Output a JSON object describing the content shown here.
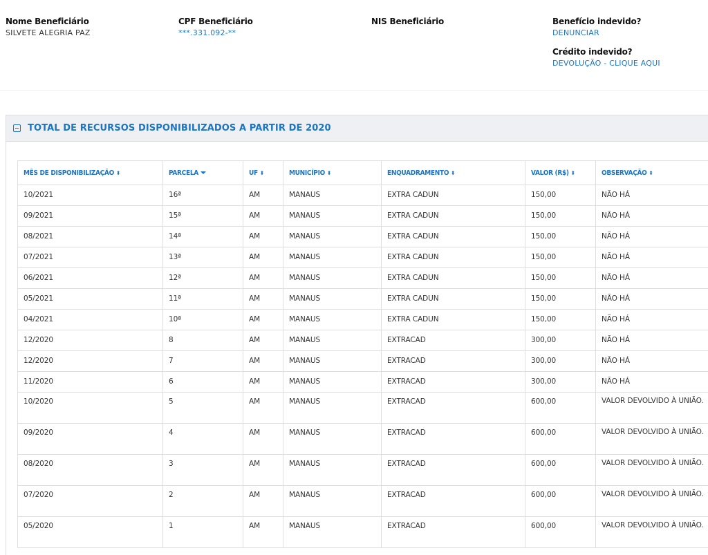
{
  "beneficiary": {
    "name_label": "Nome Beneficiário",
    "name_value": "SILVETE ALEGRIA PAZ",
    "cpf_label": "CPF Beneficiário",
    "cpf_value": "***.331.092-**",
    "nis_label": "NIS Beneficiário",
    "nis_value": "",
    "undue_benefit_label": "Benefício indevido?",
    "undue_benefit_link": "DENUNCIAR",
    "undue_credit_label": "Crédito indevido?",
    "undue_credit_link": "DEVOLUÇÃO - CLIQUE AQUI"
  },
  "panel": {
    "title": "TOTAL DE RECURSOS DISPONIBILIZADOS A PARTIR DE 2020",
    "icon": "collapse-minus-icon"
  },
  "table": {
    "columns": [
      {
        "label": "MÊS DE DISPONIBILIZAÇÃO",
        "sort": "both"
      },
      {
        "label": "PARCELA",
        "sort": "desc"
      },
      {
        "label": "UF",
        "sort": "both"
      },
      {
        "label": "MUNICÍPIO",
        "sort": "both"
      },
      {
        "label": "ENQUADRAMENTO",
        "sort": "both"
      },
      {
        "label": "VALOR (R$)",
        "sort": "both"
      },
      {
        "label": "OBSERVAÇÃO",
        "sort": "both"
      }
    ],
    "rows": [
      {
        "mes": "10/2021",
        "parcela": "16ª",
        "uf": "AM",
        "municipio": "MANAUS",
        "enquadramento": "EXTRA CADUN",
        "valor": "150,00",
        "observacao": "NÃO HÁ"
      },
      {
        "mes": "09/2021",
        "parcela": "15ª",
        "uf": "AM",
        "municipio": "MANAUS",
        "enquadramento": "EXTRA CADUN",
        "valor": "150,00",
        "observacao": "NÃO HÁ"
      },
      {
        "mes": "08/2021",
        "parcela": "14ª",
        "uf": "AM",
        "municipio": "MANAUS",
        "enquadramento": "EXTRA CADUN",
        "valor": "150,00",
        "observacao": "NÃO HÁ"
      },
      {
        "mes": "07/2021",
        "parcela": "13ª",
        "uf": "AM",
        "municipio": "MANAUS",
        "enquadramento": "EXTRA CADUN",
        "valor": "150,00",
        "observacao": "NÃO HÁ"
      },
      {
        "mes": "06/2021",
        "parcela": "12ª",
        "uf": "AM",
        "municipio": "MANAUS",
        "enquadramento": "EXTRA CADUN",
        "valor": "150,00",
        "observacao": "NÃO HÁ"
      },
      {
        "mes": "05/2021",
        "parcela": "11ª",
        "uf": "AM",
        "municipio": "MANAUS",
        "enquadramento": "EXTRA CADUN",
        "valor": "150,00",
        "observacao": "NÃO HÁ"
      },
      {
        "mes": "04/2021",
        "parcela": "10ª",
        "uf": "AM",
        "municipio": "MANAUS",
        "enquadramento": "EXTRA CADUN",
        "valor": "150,00",
        "observacao": "NÃO HÁ"
      },
      {
        "mes": "12/2020",
        "parcela": "8",
        "uf": "AM",
        "municipio": "MANAUS",
        "enquadramento": "EXTRACAD",
        "valor": "300,00",
        "observacao": "NÃO HÁ"
      },
      {
        "mes": "12/2020",
        "parcela": "7",
        "uf": "AM",
        "municipio": "MANAUS",
        "enquadramento": "EXTRACAD",
        "valor": "300,00",
        "observacao": "NÃO HÁ"
      },
      {
        "mes": "11/2020",
        "parcela": "6",
        "uf": "AM",
        "municipio": "MANAUS",
        "enquadramento": "EXTRACAD",
        "valor": "300,00",
        "observacao": "NÃO HÁ"
      },
      {
        "mes": "10/2020",
        "parcela": "5",
        "uf": "AM",
        "municipio": "MANAUS",
        "enquadramento": "EXTRACAD",
        "valor": "600,00",
        "observacao": "VALOR DEVOLVIDO À UNIÃO."
      },
      {
        "mes": "09/2020",
        "parcela": "4",
        "uf": "AM",
        "municipio": "MANAUS",
        "enquadramento": "EXTRACAD",
        "valor": "600,00",
        "observacao": "VALOR DEVOLVIDO À UNIÃO."
      },
      {
        "mes": "08/2020",
        "parcela": "3",
        "uf": "AM",
        "municipio": "MANAUS",
        "enquadramento": "EXTRACAD",
        "valor": "600,00",
        "observacao": "VALOR DEVOLVIDO À UNIÃO."
      },
      {
        "mes": "07/2020",
        "parcela": "2",
        "uf": "AM",
        "municipio": "MANAUS",
        "enquadramento": "EXTRACAD",
        "valor": "600,00",
        "observacao": "VALOR DEVOLVIDO À UNIÃO."
      },
      {
        "mes": "05/2020",
        "parcela": "1",
        "uf": "AM",
        "municipio": "MANAUS",
        "enquadramento": "EXTRACAD",
        "valor": "600,00",
        "observacao": "VALOR DEVOLVIDO À UNIÃO."
      }
    ]
  },
  "colors": {
    "link": "#1b75c2",
    "panel_header_bg": "#eef0f3",
    "border": "#dedede"
  }
}
